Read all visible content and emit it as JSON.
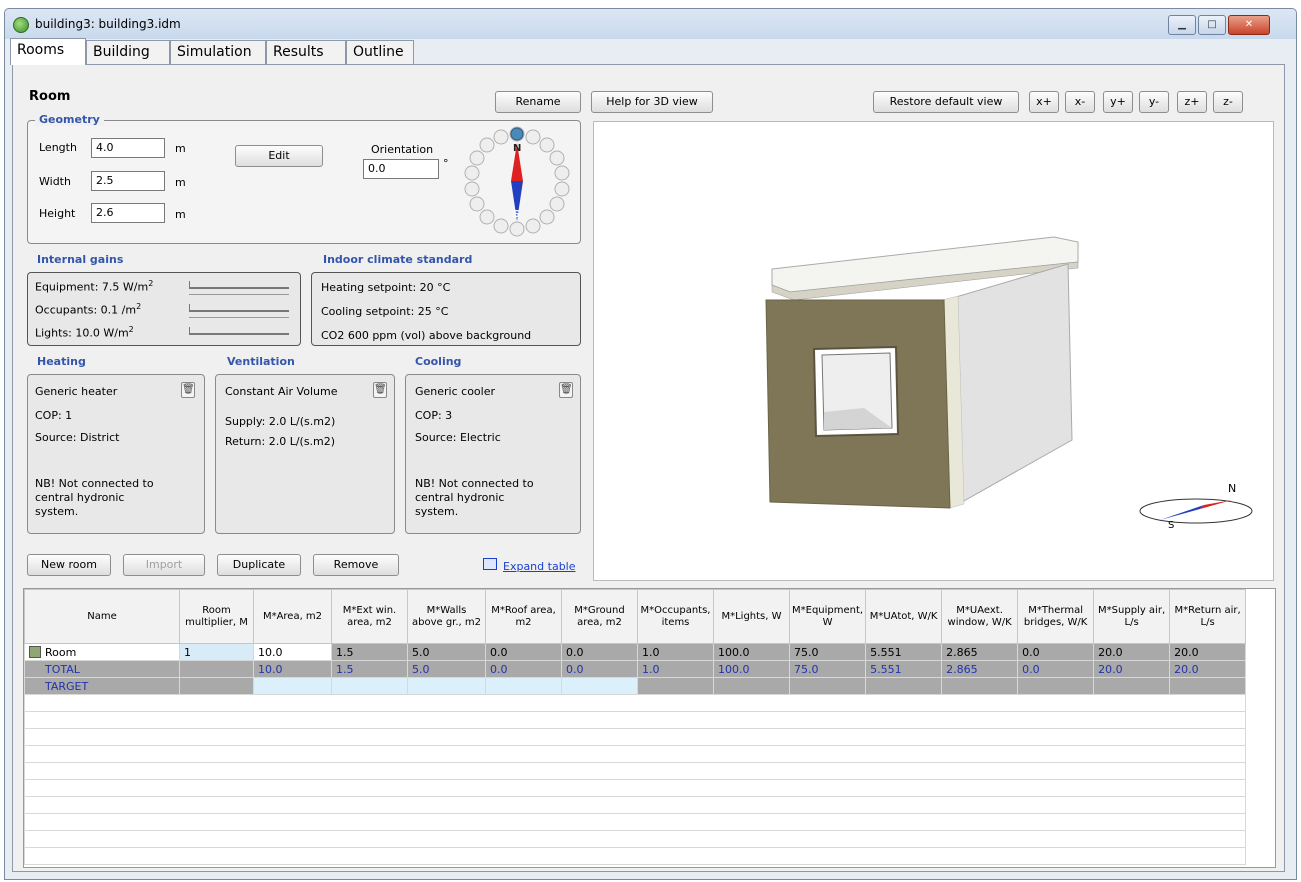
{
  "window": {
    "title": "building3: building3.idm"
  },
  "tabs": [
    "Rooms",
    "Building",
    "Simulation",
    "Results",
    "Outline"
  ],
  "room": {
    "heading": "Room",
    "rename_label": "Rename",
    "geometry_label": "Geometry",
    "length_label": "Length",
    "length_value": "4.0",
    "length_unit": "m",
    "width_label": "Width",
    "width_value": "2.5",
    "width_unit": "m",
    "height_label": "Height",
    "height_value": "2.6",
    "height_unit": "m",
    "edit_label": "Edit",
    "orientation_label": "Orientation",
    "orientation_value": "0.0",
    "orientation_unit": "°",
    "compass_n": "N",
    "compass_s": "S"
  },
  "internal_gains": {
    "label": "Internal gains",
    "equipment": "Equipment: 7.5 W/m",
    "occupants": "Occupants: 0.1 /m",
    "lights": "Lights: 10.0 W/m",
    "sup": "2"
  },
  "indoor_climate": {
    "label": "Indoor climate standard",
    "heating_setpoint": "Heating setpoint: 20  °C",
    "cooling_setpoint": "Cooling setpoint: 25  °C",
    "co2": "CO2 600 ppm (vol) above background"
  },
  "heating": {
    "label": "Heating",
    "line1": "Generic heater",
    "line2": "COP: 1",
    "line3": "Source: District",
    "note1": "NB! Not connected to",
    "note2": "central hydronic",
    "note3": "system."
  },
  "ventilation": {
    "label": "Ventilation",
    "line1": "Constant Air Volume",
    "supply": "Supply: 2.0 L/(s.m2)",
    "return": "Return: 2.0 L/(s.m2)"
  },
  "cooling": {
    "label": "Cooling",
    "line1": "Generic cooler",
    "line2": "COP: 3",
    "line3": "Source: Electric",
    "note1": "NB! Not connected to",
    "note2": "central hydronic",
    "note3": "system."
  },
  "room_buttons": {
    "new_room": "New room",
    "import": "Import",
    "duplicate": "Duplicate",
    "remove": "Remove",
    "expand_table": "Expand table"
  },
  "view3d": {
    "help": "Help for 3D view",
    "restore": "Restore default view",
    "xplus": "x+",
    "xminus": "x-",
    "yplus": "y+",
    "yminus": "y-",
    "zplus": "z+",
    "zminus": "z-",
    "mini_n": "N",
    "mini_s": "S"
  },
  "table": {
    "headers": [
      "Name",
      "Room multiplier, M",
      "M*Area, m2",
      "M*Ext win. area, m2",
      "M*Walls above gr., m2",
      "M*Roof area, m2",
      "M*Ground area, m2",
      "M*Occupants, items",
      "M*Lights, W",
      "M*Equipment, W",
      "M*UAtot, W/K",
      "M*UAext. window, W/K",
      "M*Thermal bridges, W/K",
      "M*Supply air, L/s",
      "M*Return air, L/s"
    ],
    "room_row": [
      "Room",
      "1",
      "10.0",
      "1.5",
      "5.0",
      "0.0",
      "0.0",
      "1.0",
      "100.0",
      "75.0",
      "5.551",
      "2.865",
      "0.0",
      "20.0",
      "20.0"
    ],
    "total_row": [
      "TOTAL",
      "",
      "10.0",
      "1.5",
      "5.0",
      "0.0",
      "0.0",
      "1.0",
      "100.0",
      "75.0",
      "5.551",
      "2.865",
      "0.0",
      "20.0",
      "20.0"
    ],
    "target_row": [
      "TARGET"
    ]
  },
  "colors": {
    "accent": "#3355aa",
    "link": "#1a3fd0"
  }
}
